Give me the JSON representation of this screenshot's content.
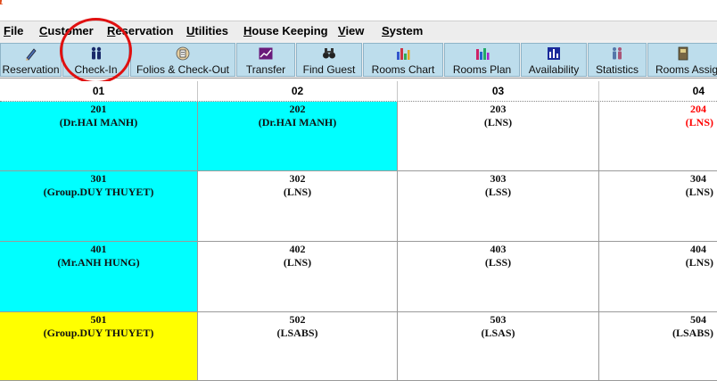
{
  "menu": [
    "File",
    "Customer",
    "Reservation",
    "Utilities",
    "House Keeping",
    "View",
    "System"
  ],
  "toolbar": [
    {
      "label": "Reservation",
      "icon": "pen-icon"
    },
    {
      "label": "Check-In",
      "icon": "people-icon"
    },
    {
      "label": "Folios & Check-Out",
      "icon": "folio-icon"
    },
    {
      "label": "Transfer",
      "icon": "transfer-icon"
    },
    {
      "label": "Find Guest",
      "icon": "binoculars-icon"
    },
    {
      "label": "Rooms Chart",
      "icon": "rooms-chart-icon"
    },
    {
      "label": "Rooms Plan",
      "icon": "rooms-plan-icon"
    },
    {
      "label": "Availability",
      "icon": "availability-icon"
    },
    {
      "label": "Statistics",
      "icon": "statistics-icon"
    },
    {
      "label": "Rooms Assig",
      "icon": "rooms-assign-icon"
    }
  ],
  "columns": [
    "01",
    "02",
    "03",
    "04"
  ],
  "rooms": [
    [
      {
        "room": "201",
        "status": "(Dr.HAI MANH)",
        "fill": "#00ffff",
        "text_color": "#111111"
      },
      {
        "room": "202",
        "status": "(Dr.HAI MANH)",
        "fill": "#00ffff",
        "text_color": "#111111"
      },
      {
        "room": "203",
        "status": "(LNS)",
        "fill": "#ffffff",
        "text_color": "#111111"
      },
      {
        "room": "204",
        "status": "(LNS)",
        "fill": "#ffffff",
        "text_color": "#ff0000"
      }
    ],
    [
      {
        "room": "301",
        "status": "(Group.DUY THUYET)",
        "fill": "#00ffff",
        "text_color": "#111111"
      },
      {
        "room": "302",
        "status": "(LNS)",
        "fill": "#ffffff",
        "text_color": "#111111"
      },
      {
        "room": "303",
        "status": "(LSS)",
        "fill": "#ffffff",
        "text_color": "#111111"
      },
      {
        "room": "304",
        "status": "(LNS)",
        "fill": "#ffffff",
        "text_color": "#111111"
      }
    ],
    [
      {
        "room": "401",
        "status": "(Mr.ANH HUNG)",
        "fill": "#00ffff",
        "text_color": "#111111"
      },
      {
        "room": "402",
        "status": "(LNS)",
        "fill": "#ffffff",
        "text_color": "#111111"
      },
      {
        "room": "403",
        "status": "(LSS)",
        "fill": "#ffffff",
        "text_color": "#111111"
      },
      {
        "room": "404",
        "status": "(LNS)",
        "fill": "#ffffff",
        "text_color": "#111111"
      }
    ],
    [
      {
        "room": "501",
        "status": "(Group.DUY THUYET)",
        "fill": "#ffff00",
        "text_color": "#111111"
      },
      {
        "room": "502",
        "status": "(LSABS)",
        "fill": "#ffffff",
        "text_color": "#111111"
      },
      {
        "room": "503",
        "status": "(LSAS)",
        "fill": "#ffffff",
        "text_color": "#111111"
      },
      {
        "room": "504",
        "status": "(LSABS)",
        "fill": "#ffffff",
        "text_color": "#111111"
      }
    ]
  ],
  "colors": {
    "highlight": "#e01010",
    "toolbar_button": "#bdddec"
  }
}
